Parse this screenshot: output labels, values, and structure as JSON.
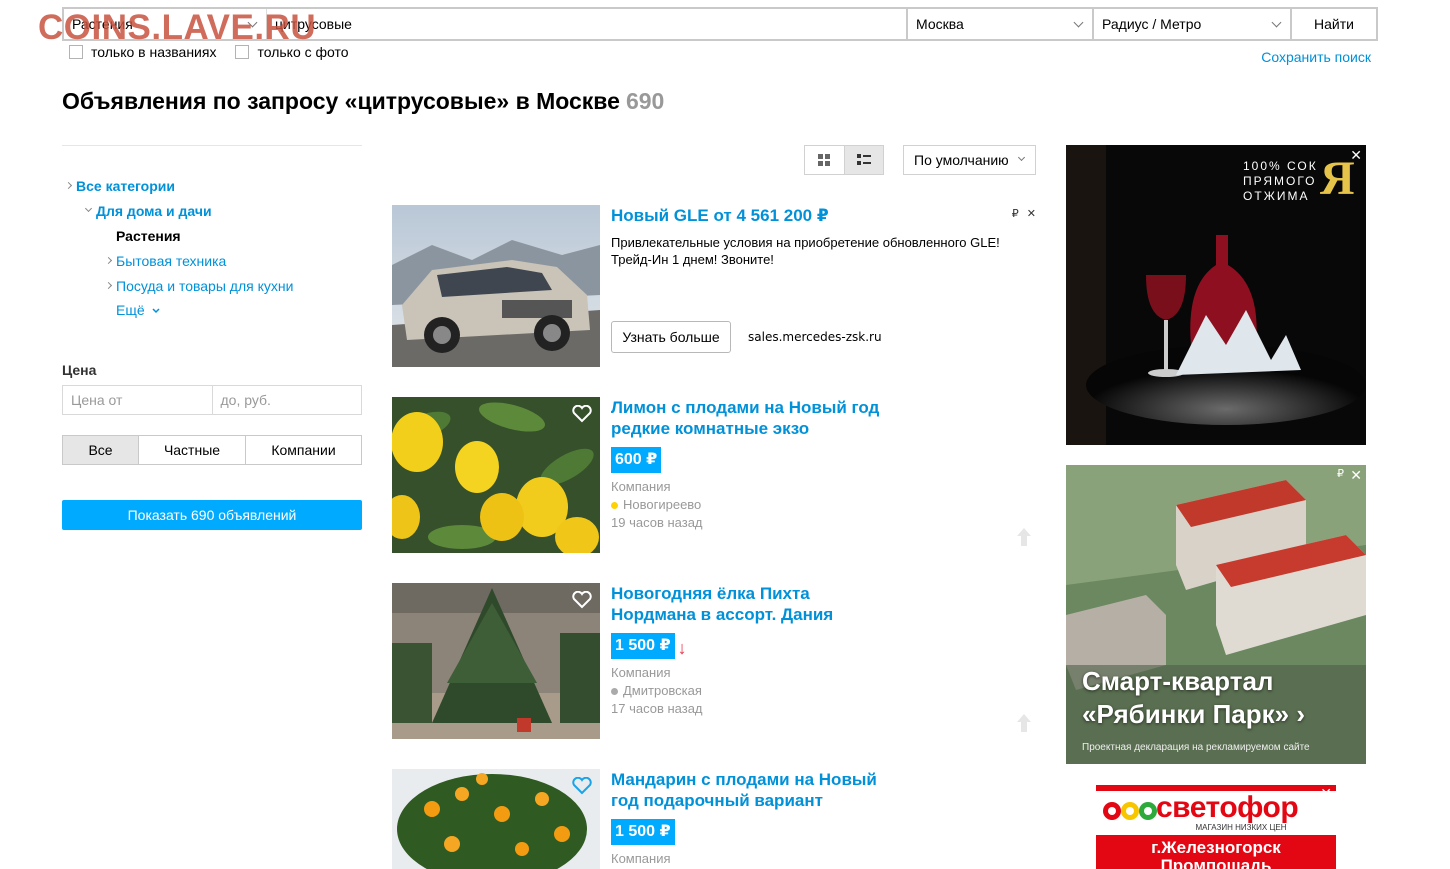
{
  "watermark": "COINS.LAVE.RU",
  "search": {
    "category": "Растения",
    "query": "цитрусовые",
    "city": "Москва",
    "radius": "Радиус / Метро",
    "button": "Найти",
    "only_titles": "только в названиях",
    "only_photo": "только с фото",
    "save_search": "Сохранить поиск"
  },
  "heading": {
    "title": "Объявления по запросу «цитрусовые» в Москве",
    "count": "690"
  },
  "categories": {
    "all": "Все категории",
    "home": "Для дома и дачи",
    "plants": "Растения",
    "appliances": "Бытовая техника",
    "kitchen": "Посуда и товары для кухни",
    "more": "Ещё"
  },
  "filters": {
    "price_label": "Цена",
    "price_from": "Цена от",
    "price_to": "до, руб.",
    "seller_all": "Все",
    "seller_private": "Частные",
    "seller_company": "Компании",
    "show_button": "Показать 690 объявлений"
  },
  "sort": "По умолчанию",
  "ad": {
    "title": "Новый GLE от 4 561 200 ₽",
    "text": "Привлекательные условия на приобретение обновленного GLE! Трейд-Ин 1 днем! Звоните!",
    "button": "Узнать больше",
    "domain": "sales.mercedes-zsk.ru",
    "currency_badge": "₽",
    "close": "✕"
  },
  "listings": [
    {
      "title": "Лимон с плодами на Новый год редкие комнатные экзо",
      "price": "600 ₽",
      "seller": "Компания",
      "metro": "Новогиреево",
      "metro_color": "#ffd200",
      "time": "19 часов назад"
    },
    {
      "title": "Новогодняя ёлка Пихта Нордмана в ассорт. Дания",
      "price": "1 500 ₽",
      "price_drop": "↓",
      "seller": "Компания",
      "metro": "Дмитровская",
      "metro_color": "#aaaaaa",
      "time": "17 часов назад"
    },
    {
      "title": "Мандарин с плодами на Новый год подарочный вариант",
      "price": "1 500 ₽",
      "seller": "Компания"
    }
  ],
  "banners": {
    "juice": {
      "line1": "100% СОК",
      "line2": "ПРЯМОГО",
      "line3": "ОТЖИМА",
      "logo": "Я",
      "close": "✕"
    },
    "estate": {
      "title": "Смарт-квартал «Рябинки Парк» ›",
      "note": "Проектная декларация на рекламируемом сайте",
      "badge": "₽",
      "close": "✕"
    },
    "svetofor": {
      "brand": "светофор",
      "sub": "МАГАЗИН НИЗКИХ ЦЕН",
      "city": "г.Железногорск",
      "street": "Промпошадь",
      "close": "✕"
    }
  }
}
